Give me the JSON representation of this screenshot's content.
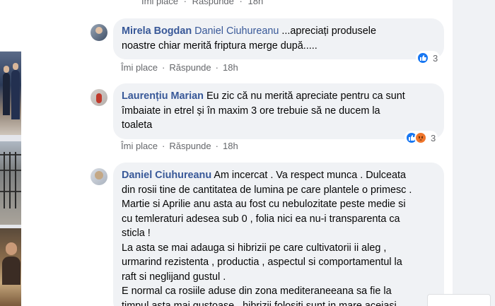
{
  "top_actions": {
    "like": "Îmi place",
    "reply": "Răspunde",
    "time": "18h"
  },
  "comments": [
    {
      "author": "Mirela Bogdan",
      "mention": "Daniel Ciuhureanu",
      "text_line1": " ...apreciați produsele",
      "text_line2": "noastre chiar merită friptura merge după.....",
      "like": "Îmi place",
      "reply": "Răspunde",
      "time": "18h",
      "reaction_count": "3",
      "reactions": [
        "like-icon"
      ]
    },
    {
      "author": "Laurențiu Marian",
      "line1": " Eu zic că nu merită apreciate pentru ca sunt",
      "line2": "îmbaiate in etrel și în maxim 3 ore trebuie să ne ducem la",
      "line3": "toaleta",
      "like": "Îmi place",
      "reply": "Răspunde",
      "time": "18h",
      "reaction_count": "3",
      "reactions": [
        "like-icon",
        "angry-icon"
      ]
    },
    {
      "author": "Daniel Ciuhureanu",
      "lines": [
        " Am incercat . Va respect munca . Dulceata",
        "din rosii tine de cantitatea de lumina pe care plantele o primesc .",
        "Martie si Aprilie anu asta au fost cu nebulozitate peste medie si",
        "cu temleraturi adesea sub 0 , folia nici ea nu-i transparenta ca",
        "sticla !",
        "La asta se mai adauga si hibrizii pe care cultivatorii ii aleg ,",
        "urmarind rezistenta , productia , aspectul si comportamentul la",
        "raft si neglijand gustul .",
        "E normal ca rosiile aduse din zona mediteraneeana sa fie la",
        "timpul asta mai gustoase , hibrizii folositi sunt in mare aceiasi ."
      ]
    }
  ],
  "colors": {
    "link_blue": "#385898",
    "bubble_bg": "#f0f2f5",
    "meta_gray": "#65676b",
    "like_blue": "#1877f2",
    "angry_orange": "#f0762c"
  }
}
